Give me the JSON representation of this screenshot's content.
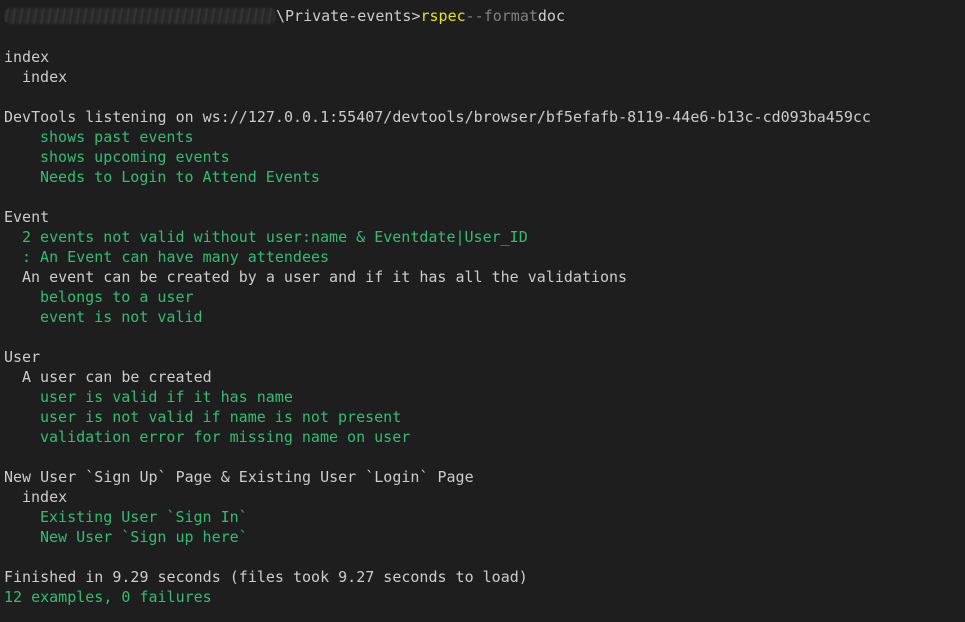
{
  "prompt": {
    "path": "\\Private-events>",
    "command": "rspec",
    "flag": "--format",
    "arg": "doc"
  },
  "output": {
    "index_group": "index",
    "index_sub": "index",
    "devtools": "DevTools listening on ws://127.0.0.1:55407/devtools/browser/bf5efafb-8119-44e6-b13c-cd093ba459cc",
    "index_tests": [
      "shows past events",
      "shows upcoming events",
      "Needs to Login to Attend Events"
    ],
    "event_group": "Event",
    "event_lines_green": [
      "2 events not valid without user:name & Eventdate|User_ID",
      ": An Event can have many attendees"
    ],
    "event_context": "An event can be created by a user and if it has all the validations",
    "event_tests": [
      "belongs to a user",
      "event is not valid"
    ],
    "user_group": "User",
    "user_context": "A user can be created",
    "user_tests": [
      "user is valid if it has name",
      "user is not valid if name is not present",
      "validation error for missing name on user"
    ],
    "page_group": "New User `Sign Up` Page & Existing User `Login` Page",
    "page_context": "index",
    "page_tests": [
      "Existing User `Sign In`",
      "New User `Sign up here`"
    ],
    "finished": "Finished in 9.29 seconds (files took 9.27 seconds to load)",
    "summary": "12 examples, 0 failures"
  },
  "colors": {
    "background": "#1e1e1e",
    "text": "#cccccc",
    "passed": "#2fbf71",
    "command": "#e5e510",
    "flag": "#808080"
  }
}
